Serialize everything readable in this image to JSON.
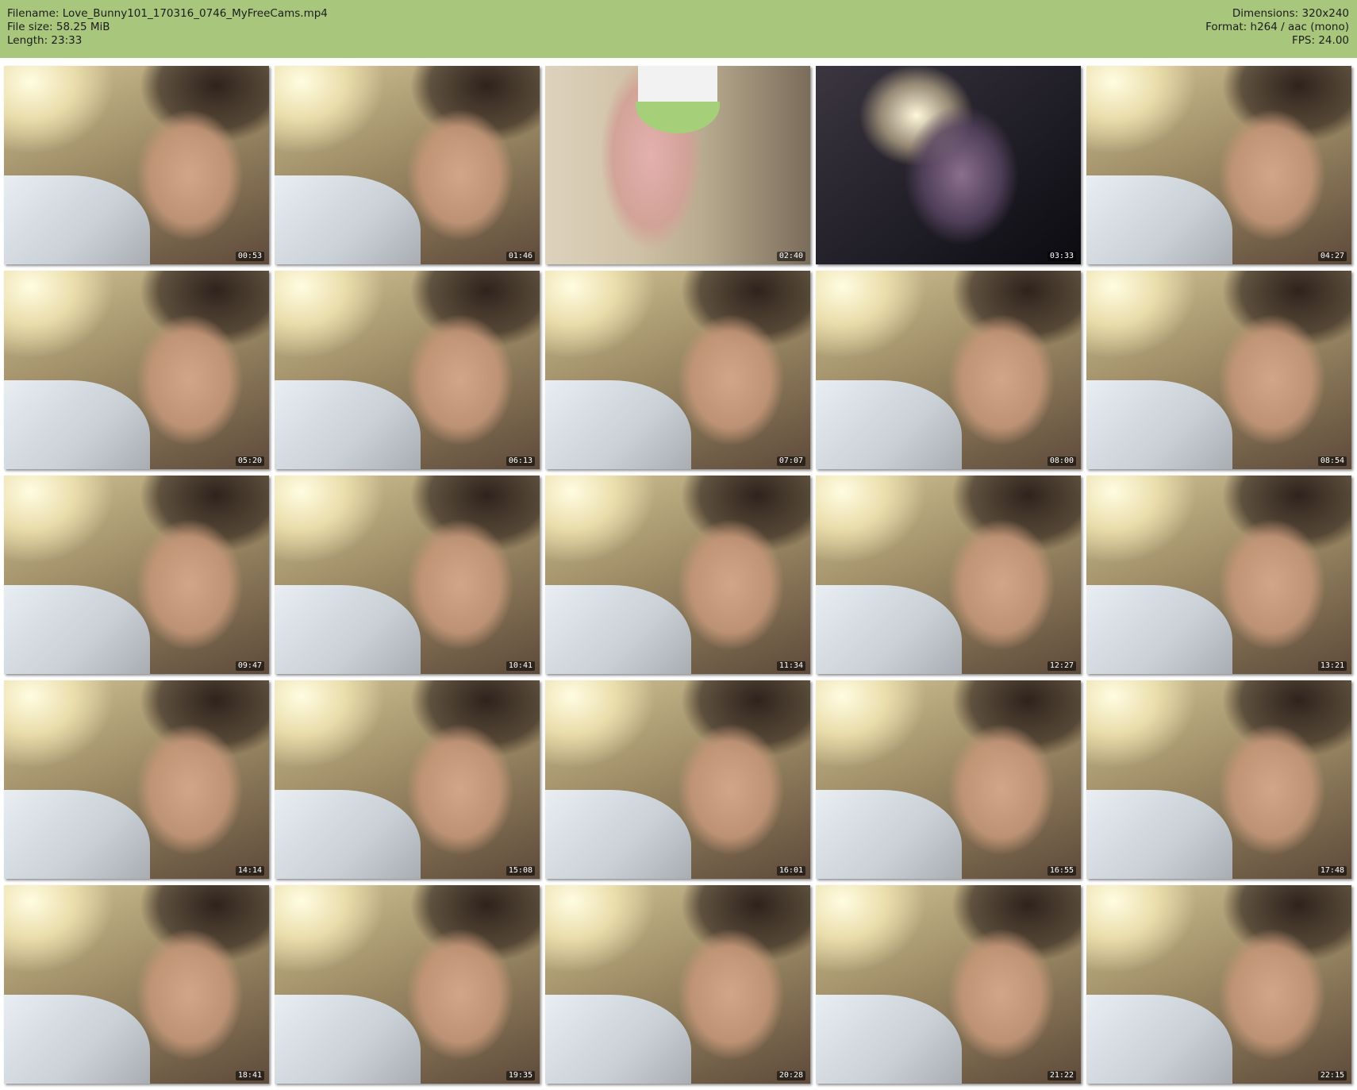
{
  "header": {
    "filename_label": "Filename: Love_Bunny101_170316_0746_MyFreeCams.mp4",
    "filesize_label": "File size: 58.25 MiB",
    "length_label": "Length: 23:33",
    "dimensions_label": "Dimensions: 320x240",
    "format_label": "Format: h264 / aac (mono)",
    "fps_label": "FPS: 24.00"
  },
  "thumbnails": [
    {
      "timestamp": "00:53",
      "scene": "a"
    },
    {
      "timestamp": "01:46",
      "scene": "a"
    },
    {
      "timestamp": "02:40",
      "scene": "b"
    },
    {
      "timestamp": "03:33",
      "scene": "c"
    },
    {
      "timestamp": "04:27",
      "scene": "a"
    },
    {
      "timestamp": "05:20",
      "scene": "a"
    },
    {
      "timestamp": "06:13",
      "scene": "a"
    },
    {
      "timestamp": "07:07",
      "scene": "a"
    },
    {
      "timestamp": "08:00",
      "scene": "a"
    },
    {
      "timestamp": "08:54",
      "scene": "a"
    },
    {
      "timestamp": "09:47",
      "scene": "a"
    },
    {
      "timestamp": "10:41",
      "scene": "a"
    },
    {
      "timestamp": "11:34",
      "scene": "a"
    },
    {
      "timestamp": "12:27",
      "scene": "a"
    },
    {
      "timestamp": "13:21",
      "scene": "a"
    },
    {
      "timestamp": "14:14",
      "scene": "a"
    },
    {
      "timestamp": "15:08",
      "scene": "a"
    },
    {
      "timestamp": "16:01",
      "scene": "a"
    },
    {
      "timestamp": "16:55",
      "scene": "a"
    },
    {
      "timestamp": "17:48",
      "scene": "a"
    },
    {
      "timestamp": "18:41",
      "scene": "a"
    },
    {
      "timestamp": "19:35",
      "scene": "a"
    },
    {
      "timestamp": "20:28",
      "scene": "a"
    },
    {
      "timestamp": "21:22",
      "scene": "a"
    },
    {
      "timestamp": "22:15",
      "scene": "a"
    }
  ],
  "colors": {
    "header_background": "#a9c77c",
    "page_background": "#ffffff"
  }
}
